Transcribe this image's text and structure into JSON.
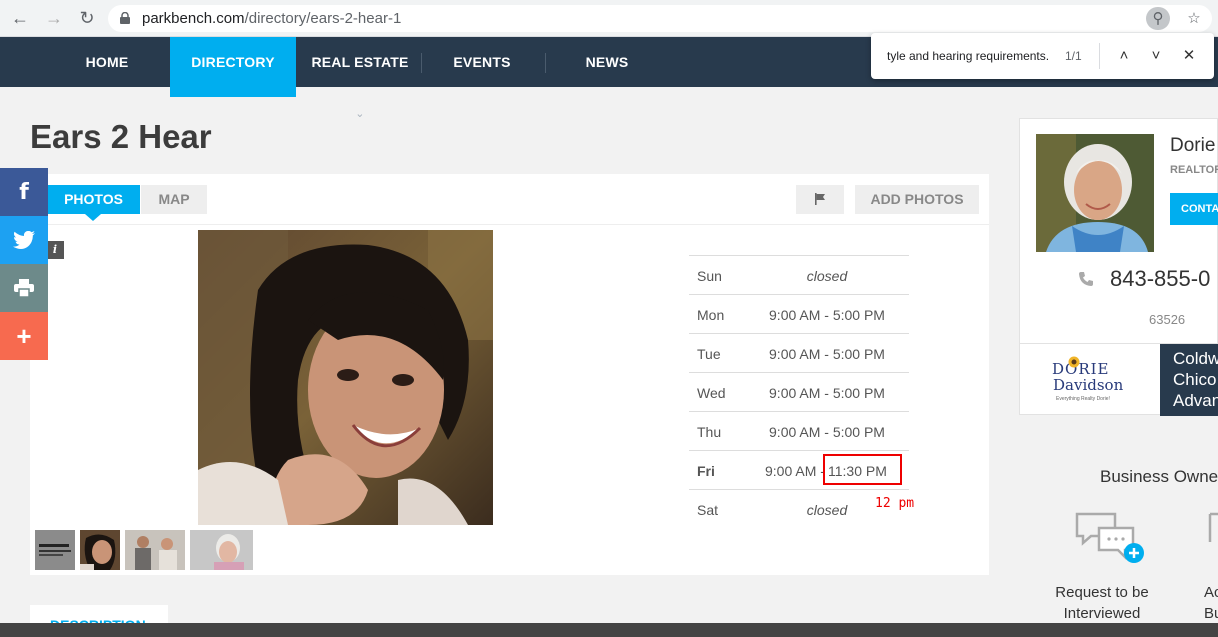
{
  "browser": {
    "url_domain": "parkbench.com",
    "url_path": "/directory/ears-2-hear-1"
  },
  "find_bar": {
    "query": "tyle and hearing requirements.",
    "count": "1/1"
  },
  "nav": {
    "items": [
      {
        "label": "HOME"
      },
      {
        "label": "DIRECTORY"
      },
      {
        "label": "REAL ESTATE"
      },
      {
        "label": "EVENTS"
      },
      {
        "label": "NEWS"
      }
    ],
    "active": "DIRECTORY",
    "active_color": "#00aeef",
    "bar_color": "#283a4d"
  },
  "listing": {
    "title": "Ears 2 Hear",
    "tabs": {
      "photos": "PHOTOS",
      "map": "MAP"
    },
    "add_photos": "ADD PHOTOS",
    "info_badge": "i",
    "description_tab": "DESCRIPTION"
  },
  "hours": {
    "rows": [
      {
        "day": "Sun",
        "time": "closed"
      },
      {
        "day": "Mon",
        "time": "9:00 AM - 5:00 PM"
      },
      {
        "day": "Tue",
        "time": "9:00 AM - 5:00 PM"
      },
      {
        "day": "Wed",
        "time": "9:00 AM - 5:00 PM"
      },
      {
        "day": "Thu",
        "time": "9:00 AM - 5:00 PM"
      },
      {
        "day": "Fri",
        "open": "9:00 AM -",
        "close": "11:30 PM"
      },
      {
        "day": "Sat",
        "time": "closed"
      }
    ],
    "annotation": "12 pm"
  },
  "social": {
    "facebook_color": "#3b5998",
    "twitter_color": "#1da1f2",
    "print_color": "#6d8a8a",
    "more_color": "#f76a4f"
  },
  "agent": {
    "name": "Dorie",
    "role": "REALTOR",
    "contact": "CONTA",
    "phone": "843-855-0",
    "zip": "63526",
    "brand_name_line1": "DORIE",
    "brand_name_line2": "Davidson",
    "brand_tagline": "Everything Realty Dorie!",
    "brand_dark_lines": [
      "Coldw",
      "Chico",
      "Advan"
    ]
  },
  "business_owners": {
    "heading": "Business Owne",
    "request_label": "Request to be Interviewed",
    "next_label": "Ac\nBu"
  }
}
